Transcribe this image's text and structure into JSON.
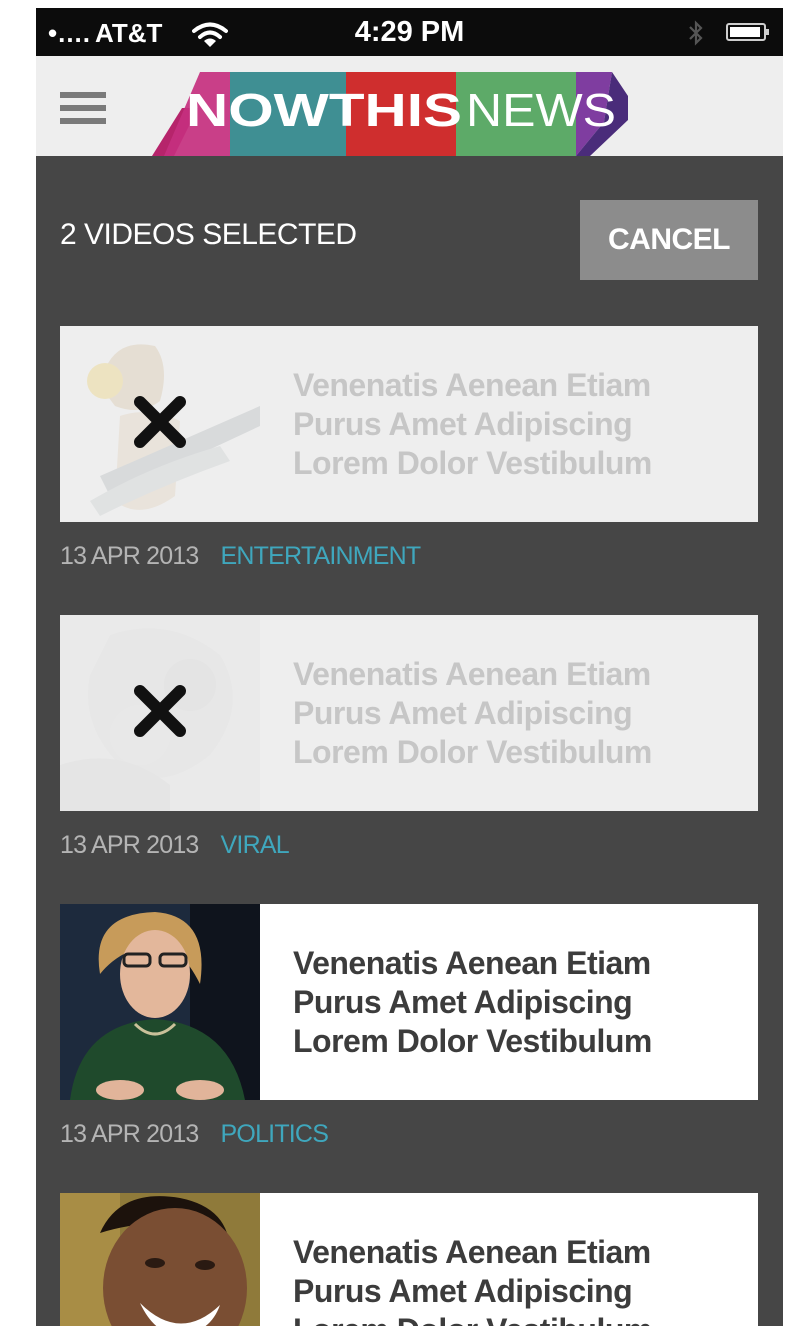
{
  "status_bar": {
    "carrier": "AT&T",
    "carrier_dots": "•....",
    "time": "4:29 PM"
  },
  "header": {
    "logo_now_this": "NOWTHIS",
    "logo_news": "NEWS"
  },
  "selection_bar": {
    "label": "2 VIDEOS SELECTED",
    "cancel_label": "CANCEL"
  },
  "feed": [
    {
      "title_lines": [
        "Venenatis Aenean Etiam",
        "Purus Amet Adipiscing",
        "Lorem Dolor Vestibulum"
      ],
      "date": "13 APR 2013",
      "category": "ENTERTAINMENT",
      "selected": true
    },
    {
      "title_lines": [
        "Venenatis Aenean Etiam",
        "Purus Amet Adipiscing",
        "Lorem Dolor Vestibulum"
      ],
      "date": "13 APR 2013",
      "category": "VIRAL",
      "selected": true
    },
    {
      "title_lines": [
        "Venenatis Aenean Etiam",
        "Purus Amet Adipiscing",
        "Lorem Dolor Vestibulum"
      ],
      "date": "13 APR 2013",
      "category": "POLITICS",
      "selected": false
    },
    {
      "title_lines": [
        "Venenatis Aenean Etiam",
        "Purus Amet Adipiscing",
        "Lorem Dolor Vestibulum"
      ],
      "selected": false
    }
  ],
  "colors": {
    "background": "#464646",
    "header": "#eeeeee",
    "cancel_button": "#8c8c8c",
    "category": "#3fa7bd",
    "date": "#b4b4b4"
  },
  "icons": {
    "menu": "hamburger-icon",
    "wifi": "wifi-icon",
    "bluetooth": "bluetooth-icon",
    "battery": "battery-icon",
    "deselect": "x-icon"
  }
}
